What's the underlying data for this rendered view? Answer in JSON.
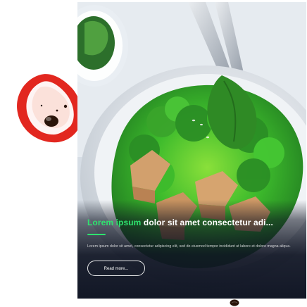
{
  "card": {
    "title_accent": "Lorem ipsum",
    "title_rest": " dolor sit amet consectetur adi...",
    "description": "Lorem ipsum dolor sit amet, consectetur adipiscing elit, sed do eiusmod tempor incididunt ut labore et dolore magna aliqua.",
    "button_label": "Read more..."
  },
  "colors": {
    "accent": "#2ee36f",
    "overlay": "#0e1322"
  },
  "icons": {
    "decor_left": "red-pepper-icon",
    "decor_bottom": "coffee-bean-icon"
  }
}
